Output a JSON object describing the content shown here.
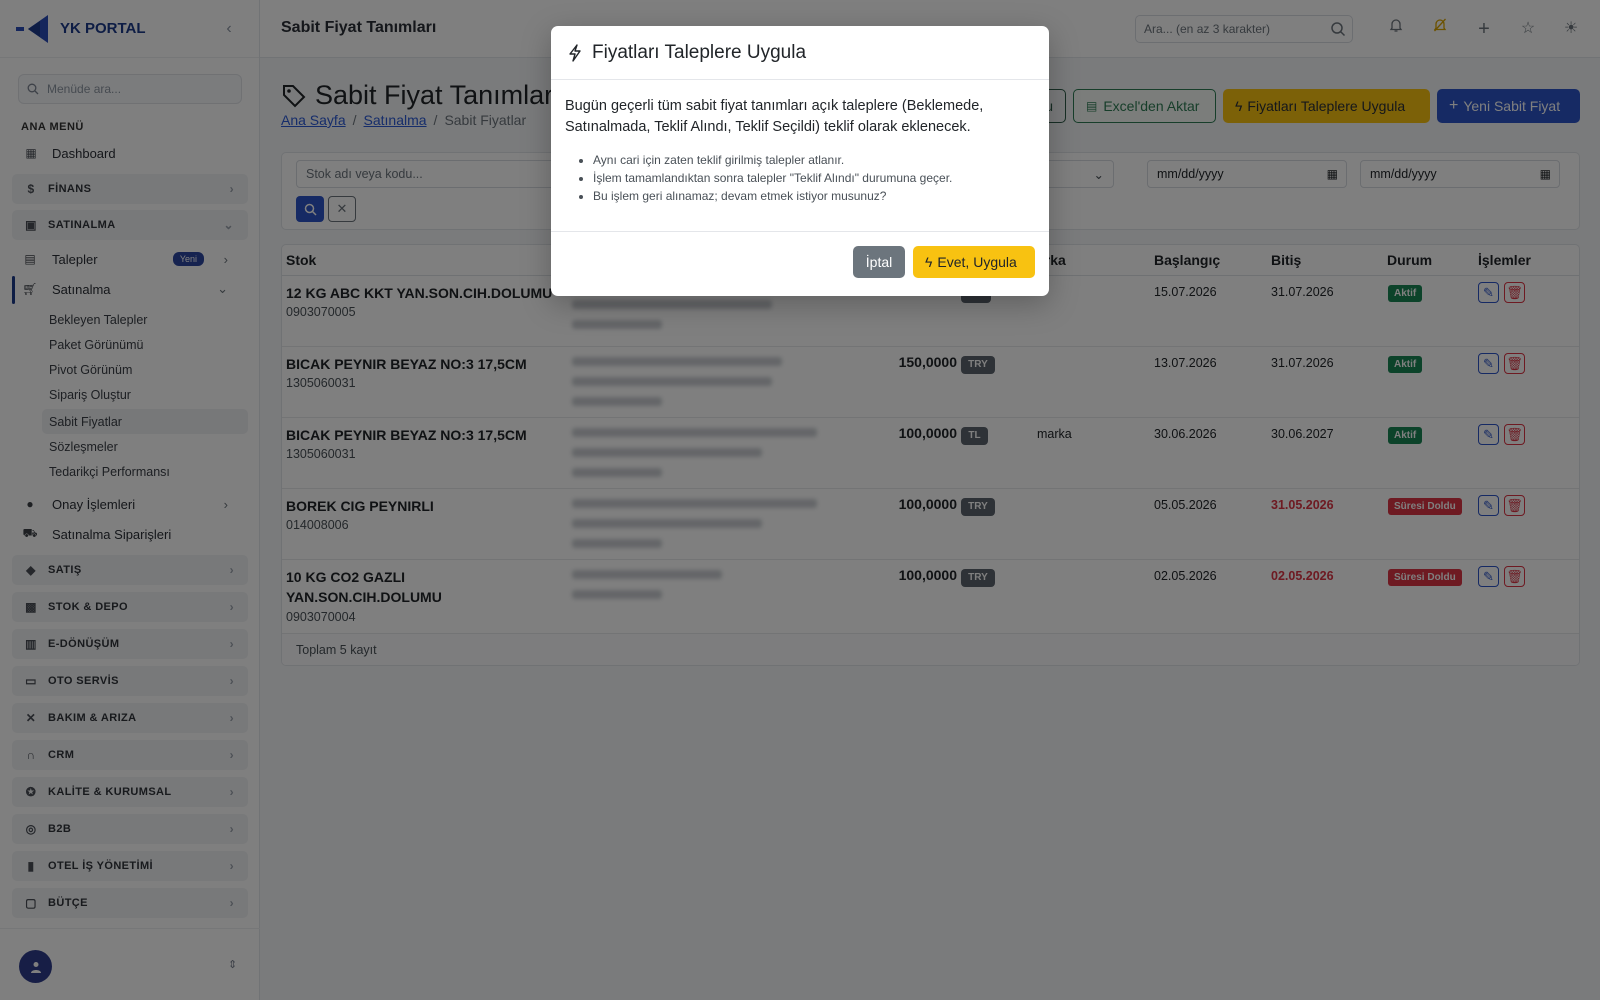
{
  "brand": {
    "name": "YK PORTAL"
  },
  "sidebar": {
    "search_placeholder": "Menüde ara...",
    "section_title": "ANA MENÜ",
    "dashboard": "Dashboard",
    "groups": [
      "FİNANS",
      "SATINALMA",
      "SATIŞ",
      "STOK & DEPO",
      "E-DÖNÜŞÜM",
      "OTO SERVİS",
      "BAKIM & ARIZA",
      "CRM",
      "KALİTE & KURUMSAL",
      "B2B",
      "OTEL İŞ YÖNETİMİ",
      "BÜTÇE"
    ],
    "satinalma": {
      "talepler": "Talepler",
      "talepler_badge": "Yeni",
      "satinalma": "Satınalma",
      "sub_items": [
        "Bekleyen Talepler",
        "Paket Görünümü",
        "Pivot Görünüm",
        "Sipariş Oluştur",
        "Sabit Fiyatlar",
        "Sözleşmeler",
        "Tedarikçi Performansı"
      ],
      "onay": "Onay İşlemleri",
      "siparisler": "Satınalma Siparişleri"
    }
  },
  "topbar": {
    "title": "Sabit Fiyat Tanımları",
    "search_placeholder": "Ara... (en az 3 karakter)"
  },
  "page": {
    "title": "Sabit Fiyat Tanımları",
    "breadcrumb": [
      "Ana Sayfa",
      "Satınalma",
      "Sabit Fiyatlar"
    ],
    "buttons": {
      "partial": "u",
      "excel": "Excel'den Aktar",
      "apply": "Fiyatları Taleplere Uygula",
      "new": "Yeni Sabit Fiyat"
    }
  },
  "filters": {
    "stock_placeholder": "Stok adı veya kodu...",
    "date_placeholder": "mm/dd/yyyy"
  },
  "table": {
    "headers": [
      "Stok",
      "arka",
      "Başlangıç",
      "Bitiş",
      "Durum",
      "İşlemler"
    ],
    "rows": [
      {
        "name": "12 KG ABC KKT YAN.SON.CIH.DOLUMU",
        "code": "0903070005",
        "price": "",
        "currency": "",
        "brand": "",
        "start": "15.07.2026",
        "end": "31.07.2026",
        "status": "Aktif",
        "expired": false
      },
      {
        "name": "BICAK PEYNIR BEYAZ NO:3 17,5CM",
        "code": "1305060031",
        "price": "150,0000",
        "currency": "TRY",
        "brand": "",
        "start": "13.07.2026",
        "end": "31.07.2026",
        "status": "Aktif",
        "expired": false
      },
      {
        "name": "BICAK PEYNIR BEYAZ NO:3 17,5CM",
        "code": "1305060031",
        "price": "100,0000",
        "currency": "TL",
        "brand": "marka",
        "start": "30.06.2026",
        "end": "30.06.2027",
        "status": "Aktif",
        "expired": false
      },
      {
        "name": "BOREK CIG PEYNIRLI",
        "code": "014008006",
        "price": "100,0000",
        "currency": "TRY",
        "brand": "",
        "start": "05.05.2026",
        "end": "31.05.2026",
        "status": "Süresi Doldu",
        "expired": true
      },
      {
        "name": "10 KG CO2 GAZLI YAN.SON.CIH.DOLUMU",
        "code": "0903070004",
        "price": "100,0000",
        "currency": "TRY",
        "brand": "",
        "start": "02.05.2026",
        "end": "02.05.2026",
        "status": "Süresi Doldu",
        "expired": true
      }
    ],
    "footer": "Toplam 5 kayıt"
  },
  "modal": {
    "title": "Fiyatları Taleplere Uygula",
    "lead": "Bugün geçerli tüm sabit fiyat tanımları açık taleplere (Beklemede, Satınalmada, Teklif Alındı, Teklif Seçildi) teklif olarak eklenecek.",
    "bullets": [
      "Aynı cari için zaten teklif girilmiş talepler atlanır.",
      "İşlem tamamlandıktan sonra talepler \"Teklif Alındı\" durumuna geçer.",
      "Bu işlem geri alınamaz; devam etmek istiyor musunuz?"
    ],
    "cancel": "İptal",
    "confirm": "Evet, Uygula"
  },
  "colors": {
    "primary": "#2d55c8",
    "warning": "#f8c211",
    "success": "#198754",
    "danger": "#dc3545",
    "brand": "#1d3a8a"
  }
}
